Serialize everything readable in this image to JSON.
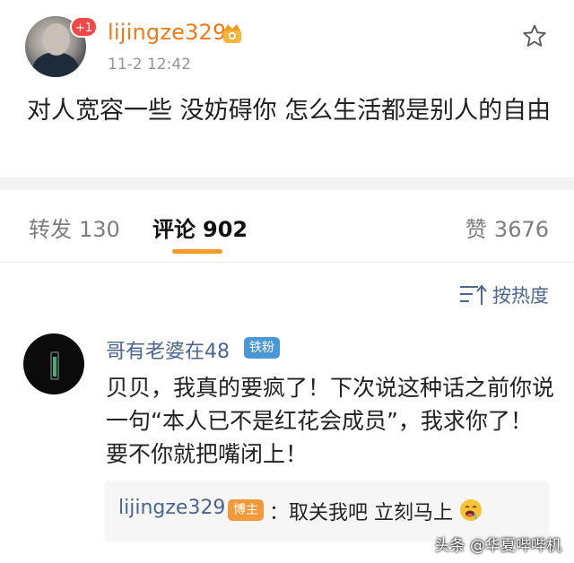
{
  "post": {
    "username": "lijingze329",
    "notification_count": "+1",
    "timestamp": "11-2 12:42",
    "text": "对人宽容一些 没妨碍你 怎么生活都是别人的自由",
    "vip_icon": "crown-badge-icon",
    "favorite_icon": "star-icon"
  },
  "tabs": {
    "repost_label": "转发",
    "repost_count": "130",
    "comment_label": "评论",
    "comment_count": "902",
    "like_label": "赞",
    "like_count": "3676",
    "active": "comment",
    "accent_color": "#f39c2a"
  },
  "sort": {
    "label": "按热度",
    "icon": "sort-icon"
  },
  "comment": {
    "author": "哥有老婆在48",
    "fan_badge": "铁粉",
    "text": "贝贝，我真的要疯了！下次说这种话之前你说一句“本人已不是红花会成员”，我求你了！要不你就把嘴闭上！"
  },
  "reply": {
    "author": "lijingze329",
    "host_badge": "博主",
    "text": "：取关我吧 立刻马上",
    "emoji": "drooling-face-icon"
  },
  "watermark": "头条 @华夏哔哔机"
}
